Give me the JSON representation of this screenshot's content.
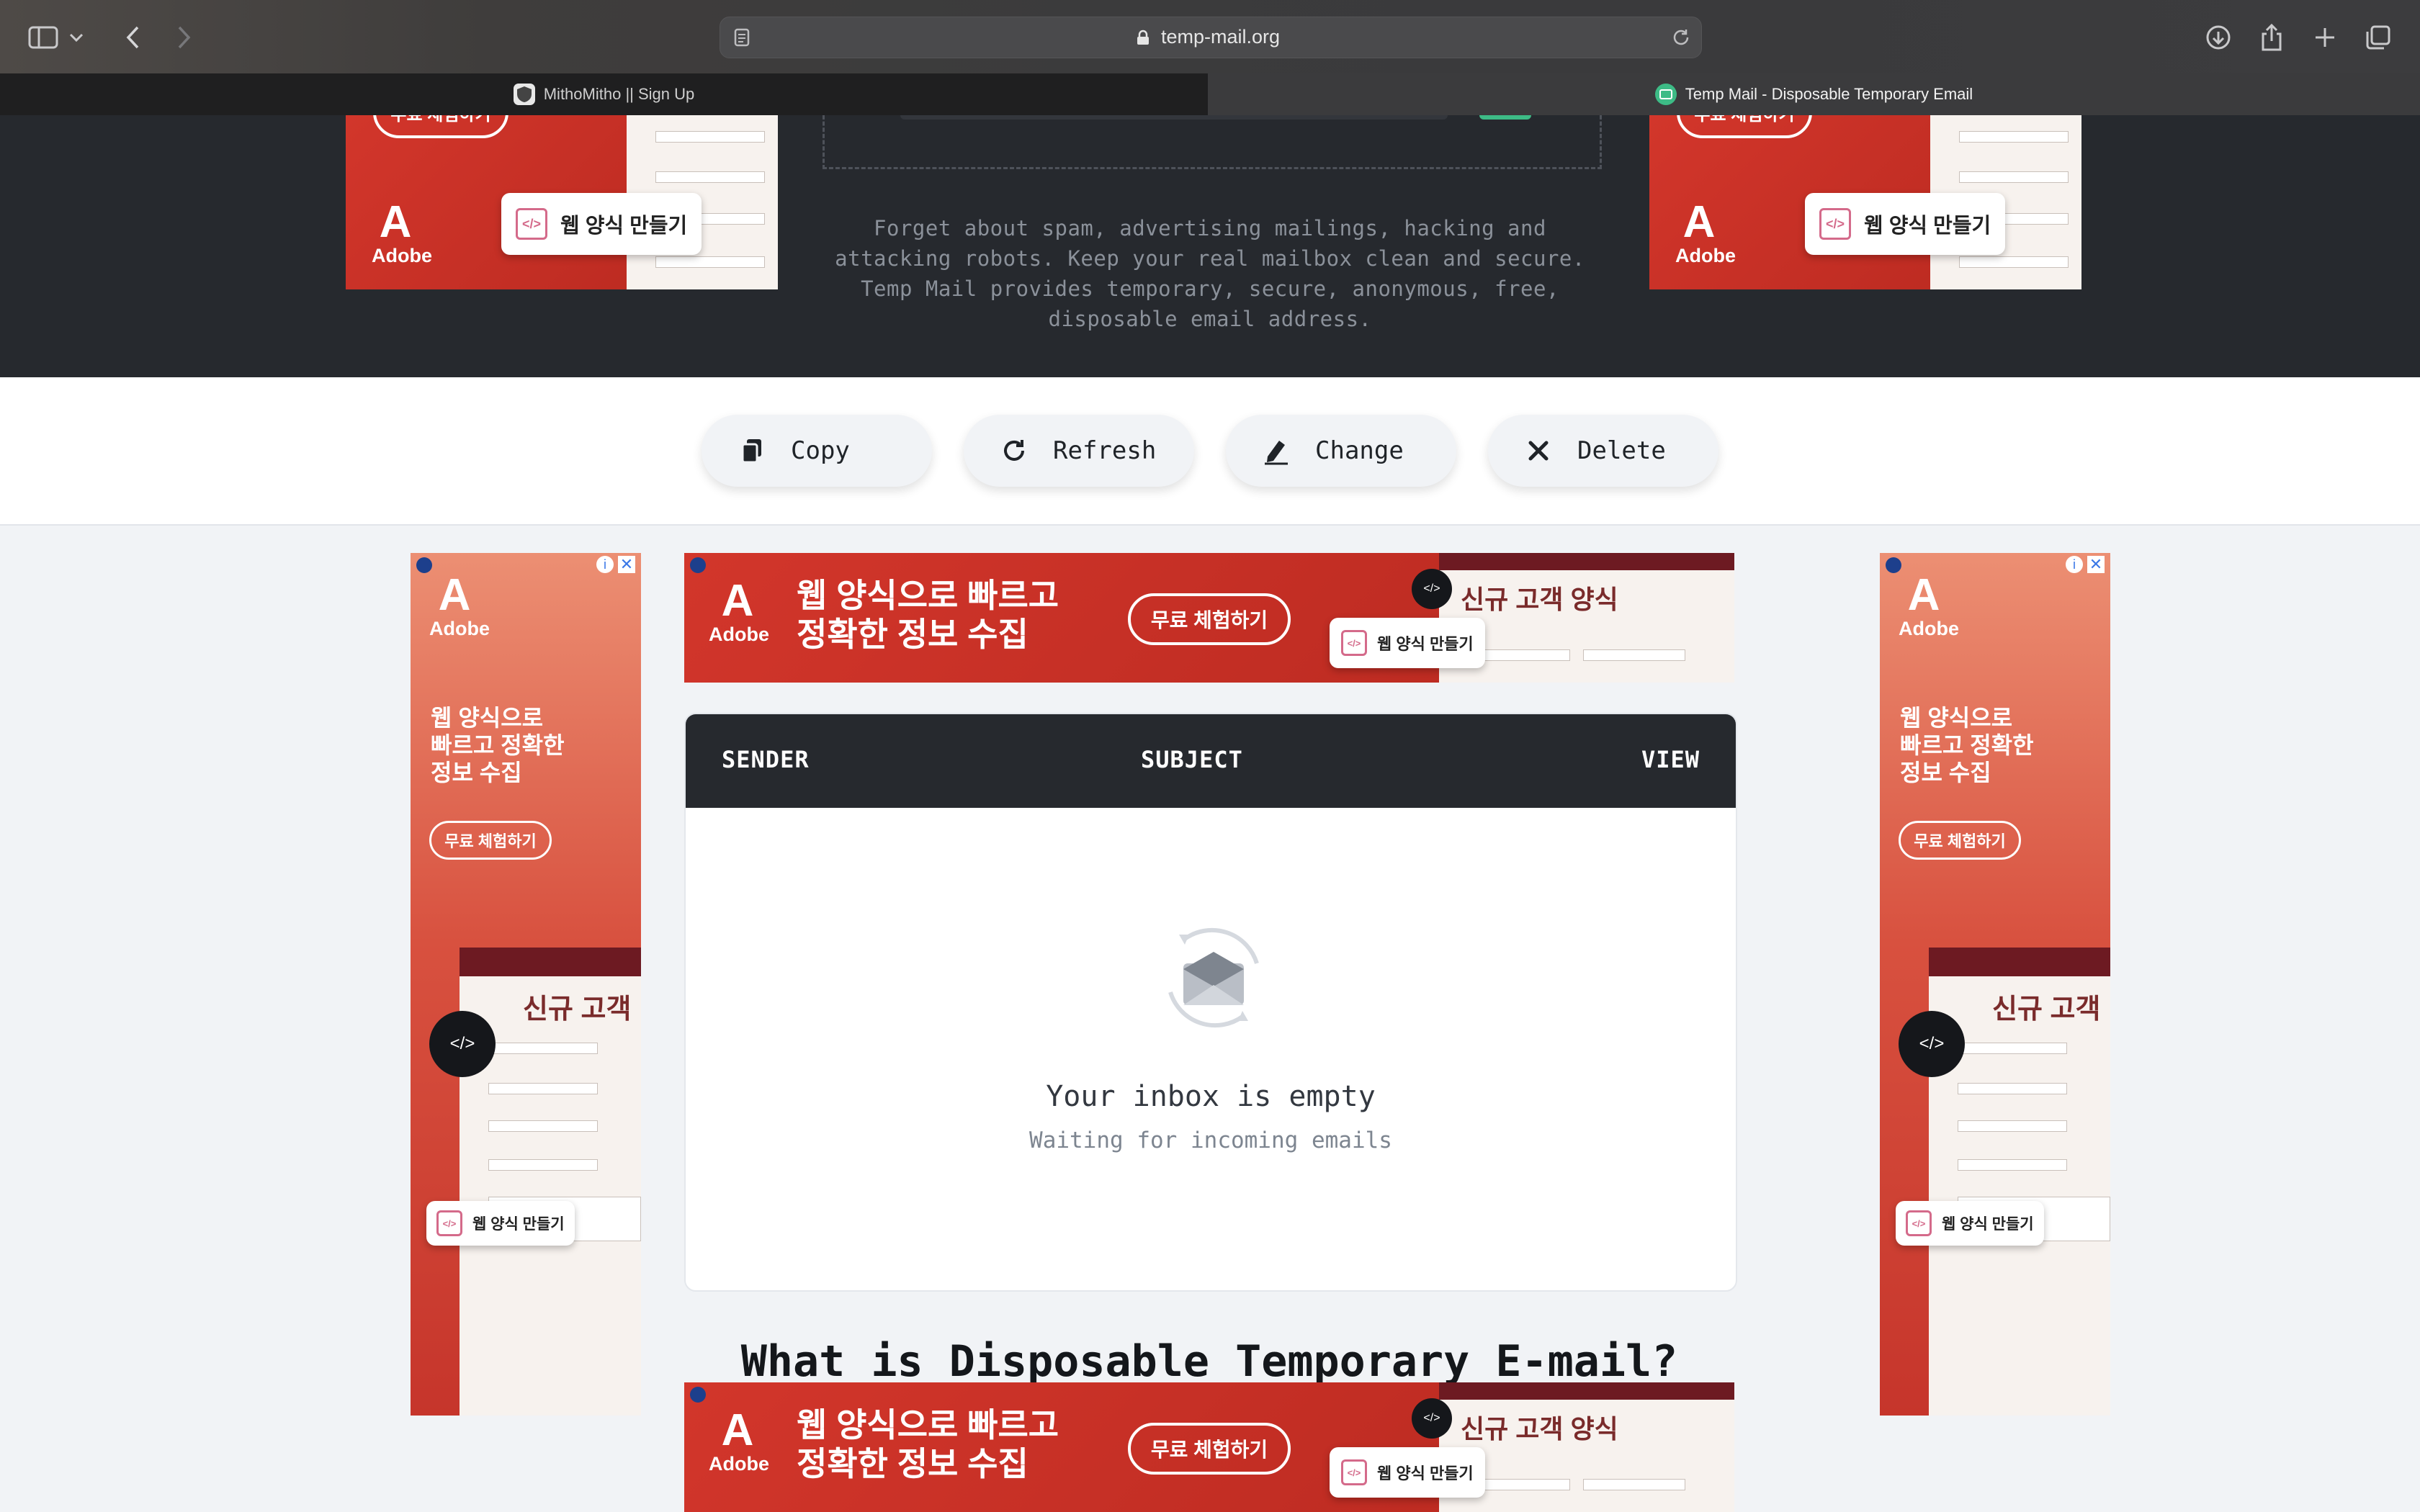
{
  "browser": {
    "url": "temp-mail.org",
    "tabs": [
      {
        "label": "MithoMitho || Sign Up",
        "active": false
      },
      {
        "label": "Temp Mail - Disposable Temporary Email",
        "active": true
      }
    ],
    "icons": [
      "sidebar-icon",
      "chevron-down-icon",
      "back-icon",
      "forward-icon",
      "reader-icon",
      "lock-icon",
      "reload-icon",
      "download-icon",
      "share-icon",
      "new-tab-icon",
      "tab-overview-icon"
    ]
  },
  "hero": {
    "description": "Forget about spam, advertising mailings, hacking and attacking robots. Keep your real mailbox clean and secure. Temp Mail provides temporary, secure, anonymous, free, disposable email address."
  },
  "actions": {
    "copy": "Copy",
    "refresh": "Refresh",
    "change": "Change",
    "delete": "Delete"
  },
  "inbox": {
    "columns": {
      "sender": "SENDER",
      "subject": "SUBJECT",
      "view": "VIEW"
    },
    "empty_title": "Your inbox is empty",
    "empty_subtitle": "Waiting for incoming emails"
  },
  "section_title": "What is Disposable Temporary E-mail?",
  "ads": {
    "brand": "Adobe",
    "logo_glyph": "A",
    "pill": "웹 양식 만들기",
    "headline_line1": "웹 양식으로 빠르고",
    "headline_line2": "정확한 정보 수집",
    "trial": "무료 체험하기",
    "customer_form": "신규 고객 양식",
    "customer": "신규 고객",
    "side_line1": "웹 양식으로",
    "side_line2": "빠르고 정확한",
    "side_line3": "정보 수집",
    "top_cut": "무료 체험하기"
  },
  "colors": {
    "hero_bg": "#26292e",
    "page_bg": "#f1f3f6",
    "ad_red": "#c9302a",
    "accent_green": "#3dbb86"
  }
}
